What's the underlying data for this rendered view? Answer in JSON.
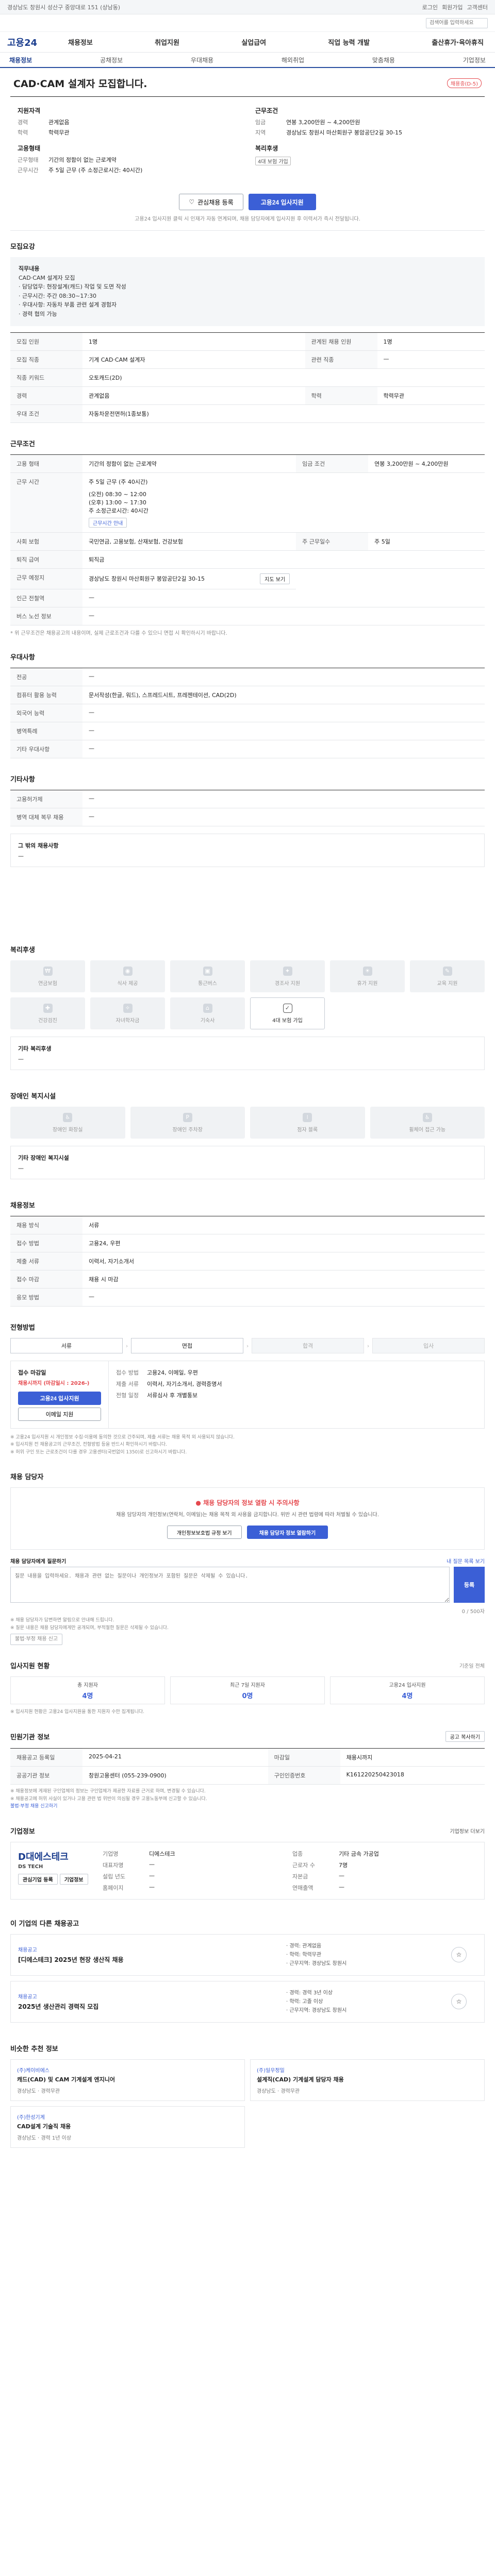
{
  "topbar": {
    "left": "경상남도 창원시 성산구 중앙대로 151 (상남동)",
    "right_links": [
      "로그인",
      "회원가입",
      "고객센터"
    ]
  },
  "search": {
    "placeholder": "검색어를 입력하세요"
  },
  "header": {
    "logo": "고용24",
    "nav": [
      "채용정보",
      "취업지원",
      "실업급여",
      "직업 능력 개발",
      "출산휴가·육아휴직"
    ],
    "subnav": [
      "채용정보",
      "공채정보",
      "우대채용",
      "해외취업",
      "맞춤채용",
      "기업정보"
    ]
  },
  "job": {
    "title": "CAD·CAM 설계자 모집합니다.",
    "status_badge": "채용중(D-5)",
    "applicant_section": "지원자격",
    "career_label": "경력",
    "career_value": "관계없음",
    "edu_label": "학력",
    "edu_value": "학력무관",
    "employ_section": "고용형태",
    "employ_label": "근무형태",
    "employ_value": "기간의 정함이 없는 근로계약",
    "work_label": "근무시간",
    "work_value": "주 5일 근무 (주 소정근로시간: 40시간)",
    "cond_section": "근무조건",
    "wage_label": "임금",
    "wage_value": "연봉 3,200만원 ~ 4,200만원",
    "loc_label": "지역",
    "loc_value": "경상남도 창원시 마산회원구 봉암공단2길 30-15",
    "welfare_section": "복리후생",
    "welfare_tag": "4대 보험 가입",
    "scrap_button": "관심채용 등록",
    "apply_button": "고용24 입사지원",
    "notice": "고용24 입사지원 클릭 시 인재가 자동 연계되며, 채용 담당자에게 입사지원 후 이력서가 즉시 전달됩니다."
  },
  "recruit": {
    "title": "모집요강",
    "duty_label": "직무내용",
    "duty_text": [
      "CAD·CAM 설계자 모집",
      "· 담당업무: 현장설계(캐드) 작업 및 도면 작성",
      "· 근무시간: 주간 08:30~17:30",
      "· 우대사항: 자동차 부품 관련 설계 경험자",
      "· 경력 협의 가능"
    ],
    "rows": [
      {
        "k": "모집 인원",
        "v": "1명",
        "k2": "관계된 채용 인원",
        "v2": "1명"
      },
      {
        "k": "모집 직종",
        "v": "기계 CAD·CAM 설계자",
        "k2": "관련 직종",
        "v2": "—"
      },
      {
        "k": "직종 키워드",
        "v": "오토캐드(2D)",
        "k2": "",
        "v2": ""
      },
      {
        "k": "경력",
        "v": "관계없음",
        "k2": "학력",
        "v2": "학력무관"
      },
      {
        "k": "우대 조건",
        "v": "자동차운전면허(1종보통)",
        "k2": "",
        "v2": ""
      }
    ]
  },
  "conditions": {
    "title": "근무조건",
    "employ_type_k": "고용 형태",
    "employ_type_v": "기간의 정함이 없는 근로계약",
    "wage_k": "임금 조건",
    "wage_v": "연봉 3,200만원 ~ 4,200만원",
    "meal_line": "주 5일 근무 (주 40시간)",
    "hours_k": "근무 시간",
    "hours_lines": [
      "(오전) 08:30 ~ 12:00",
      "(오후) 13:00 ~ 17:30",
      "주 소정근로시간: 40시간"
    ],
    "hours_link": "근무시간 안내",
    "ins_k": "사회 보험",
    "ins_v": "국민연금, 고용보험, 산재보험, 건강보험",
    "retire_k": "퇴직 급여",
    "retire_v": "퇴직금",
    "holiday_k": "근무 예정지",
    "holiday_v": "경상남도 창원시 마산회원구 봉암공단2길 30-15",
    "map_button": "지도 보기",
    "sub_k": "인근 전철역",
    "sub_v": "—",
    "extra_k": "버스 노선 정보",
    "extra_v": "—",
    "tail_k": "주 근무일수",
    "tail_v": "주 5일",
    "note": "* 위 근무조건은 채용공고의 내용이며, 실제 근로조건과 다를 수 있으니 면접 시 확인하시기 바랍니다."
  },
  "prefer": {
    "title": "우대사항",
    "rows": [
      {
        "k": "전공",
        "v": "—"
      },
      {
        "k": "컴퓨터 활용 능력",
        "v": "문서작성(한글, 워드), 스프레드시트, 프레젠테이션, CAD(2D)"
      },
      {
        "k": "외국어 능력",
        "v": "—"
      },
      {
        "k": "병역특례",
        "v": "—"
      },
      {
        "k": "기타 우대사항",
        "v": "—"
      }
    ]
  },
  "other": {
    "title": "기타사항",
    "rows": [
      {
        "k": "고용허가제",
        "v": "—"
      },
      {
        "k": "병역 대체 복무 채용",
        "v": "—"
      }
    ],
    "panel_title": "그 밖의 채용사항",
    "panel_text": "—"
  },
  "welfare": {
    "title": "복리후생",
    "items": [
      {
        "label": "연금보험",
        "on": false
      },
      {
        "label": "식사 제공",
        "on": false
      },
      {
        "label": "통근버스",
        "on": false
      },
      {
        "label": "경조사 지원",
        "on": false
      },
      {
        "label": "휴가 지원",
        "on": false
      },
      {
        "label": "교육 지원",
        "on": false
      },
      {
        "label": "건강검진",
        "on": false
      },
      {
        "label": "자녀학자금",
        "on": false
      },
      {
        "label": "기숙사",
        "on": false
      },
      {
        "label": "4대 보험 가입",
        "on": true
      }
    ],
    "panel_title": "기타 복리후생",
    "panel_text": "—"
  },
  "disabled": {
    "title": "장애인 복지시설",
    "items": [
      "장애인 화장실",
      "장애인 주차장",
      "점자 블록",
      "휠체어 접근 가능"
    ],
    "panel_title": "기타 장애인 복지시설",
    "panel_text": "—"
  },
  "company_info": {
    "title": "채용정보",
    "rows": [
      {
        "k": "채용 방식",
        "v": "서류",
        "k2": "",
        "v2": ""
      },
      {
        "k": "접수 방법",
        "v": "고용24, 우편",
        "k2": "",
        "v2": ""
      },
      {
        "k": "제출 서류",
        "v": "이력서, 자기소개서",
        "k2": "",
        "v2": ""
      },
      {
        "k": "접수 마감",
        "v": "채용 시 마감",
        "k2": "",
        "v2": ""
      },
      {
        "k": "응모 방법",
        "v": "—",
        "k2": "",
        "v2": ""
      }
    ]
  },
  "process": {
    "title": "전형방법",
    "steps": [
      "서류",
      "면접",
      "합격",
      "입사"
    ],
    "apply_title": "접수 마감일",
    "apply_date": "채용시까지 (마감일시 : 2026-)",
    "apply_btn": "고용24 입사지원",
    "email_btn": "이메일 지원",
    "r1_k": "접수 방법",
    "r1_v": "고용24, 이메일, 우편",
    "r2_k": "제출 서류",
    "r2_v": "이력서, 자기소개서, 경력증명서",
    "r3_k": "전형 일정",
    "r3_v": "서류심사 후 개별통보",
    "notes": [
      "※ 고용24 입사지원 시 개인정보 수집·이용에 동의한 것으로 간주되며, 제출 서류는 채용 목적 외 사용되지 않습니다.",
      "※ 입사지원 전 채용공고의 근무조건, 전형방법 등을 반드시 확인하시기 바랍니다.",
      "※ 허위 구인 또는 근로조건이 다를 경우 고용센터(국번없이 1350)로 신고하시기 바랍니다."
    ]
  },
  "contact": {
    "title": "채용 담당자",
    "box_title": "채용 담당자의 정보 열람 시 주의사항",
    "box_text": "채용 담당자의 개인정보(연락처, 이메일)는 채용 목적 외 사용을 금지합니다. 위반 시 관련 법령에 따라 처벌될 수 있습니다.",
    "btn_outline": "개인정보보호법 규정 보기",
    "btn_blue": "채용 담당자 정보 열람하기",
    "qa_label": "채용 담당자에게 질문하기",
    "qa_hint": "내 질문 목록 보기",
    "qa_placeholder": "질문 내용을 입력하세요. 채용과 관련 없는 질문이나 개인정보가 포함된 질문은 삭제될 수 있습니다.",
    "qa_count": "0 / 500자",
    "qa_submit": "등록",
    "notes": [
      "※ 채용 담당자가 답변하면 알림으로 안내해 드립니다.",
      "※ 질문 내용은 채용 담당자에게만 공개되며, 부적절한 질문은 삭제될 수 있습니다."
    ],
    "report_btn": "불법·부정 채용 신고"
  },
  "stats": {
    "title": "입사지원 현황",
    "right": "기준일 전체",
    "items": [
      {
        "label": "총 지원자",
        "num": "4명"
      },
      {
        "label": "최근 7일 지원자",
        "num": "0명"
      },
      {
        "label": "고용24 입사지원",
        "num": "4명"
      }
    ],
    "note": "※ 입사지원 현황은 고용24 입사지원을 통한 지원자 수만 집계됩니다."
  },
  "posting": {
    "title": "민원기관 정보",
    "right_btn": "공고 복사하기",
    "rows": [
      {
        "k": "채용공고 등록일",
        "v": "2025-04-21",
        "k2": "마감일",
        "v2": "채용시까지"
      },
      {
        "k": "공공기관 정보",
        "v": "창원고용센터 (055-239-0900)",
        "k2": "구인인증번호",
        "v2": "K161220250423018"
      }
    ],
    "notes": [
      "※ 채용정보에 게재된 구인업체의 정보는 구인업체가 제공한 자료를 근거로 하며, 변경될 수 있습니다.",
      "※ 채용공고에 허위 사실이 있거나 고용 관련 법 위반이 의심될 경우 고용노동부에 신고할 수 있습니다."
    ],
    "link": "불법·부정 채용 신고하기"
  },
  "company": {
    "title": "기업정보",
    "right": "기업정보 더보기",
    "logo_main": "D대에스테크",
    "logo_accent": "D",
    "logo_sub": "DS TECH",
    "btn1": "관심기업 등록",
    "btn2": "기업정보",
    "rows": [
      {
        "k": "기업명",
        "v": "디에스테크",
        "k2": "업종",
        "v2": "기타 금속 가공업"
      },
      {
        "k": "대표자명",
        "v": "—",
        "k2": "근로자 수",
        "v2": "7명"
      },
      {
        "k": "설립 년도",
        "v": "—",
        "k2": "자본금",
        "v2": "—"
      },
      {
        "k": "홈페이지",
        "v": "—",
        "k2": "연매출액",
        "v2": "—"
      }
    ]
  },
  "other_jobs": {
    "title": "이 기업의 다른 채용공고",
    "cards": [
      {
        "co": "채용공고",
        "title": "[디에스테크] 2025년 현장 생산직 채용",
        "mid": [
          "· 경력: 관계없음",
          "· 학력: 학력무관",
          "· 근무지역: 경상남도 창원시"
        ]
      },
      {
        "co": "채용공고",
        "title": "2025년 생산관리 경력직 모집",
        "mid": [
          "· 경력: 경력 3년 이상",
          "· 학력: 고졸 이상",
          "· 근무지역: 경상남도 창원시"
        ]
      }
    ]
  },
  "recommend": {
    "title": "비슷한 추천 정보",
    "cards": [
      {
        "co": "(주)케이비에스",
        "title": "캐드(CAD) 및 CAM 기계설계 엔지니어",
        "meta": "경상남도 · 경력무관"
      },
      {
        "co": "(주)일우정밀",
        "title": "설계직(CAD) 기계설계 담당자 채용",
        "meta": "경상남도 · 경력무관"
      },
      {
        "co": "(주)한성기계",
        "title": "CAD설계 기술직 채용",
        "meta": "경상남도 · 경력 1년 이상"
      }
    ]
  }
}
